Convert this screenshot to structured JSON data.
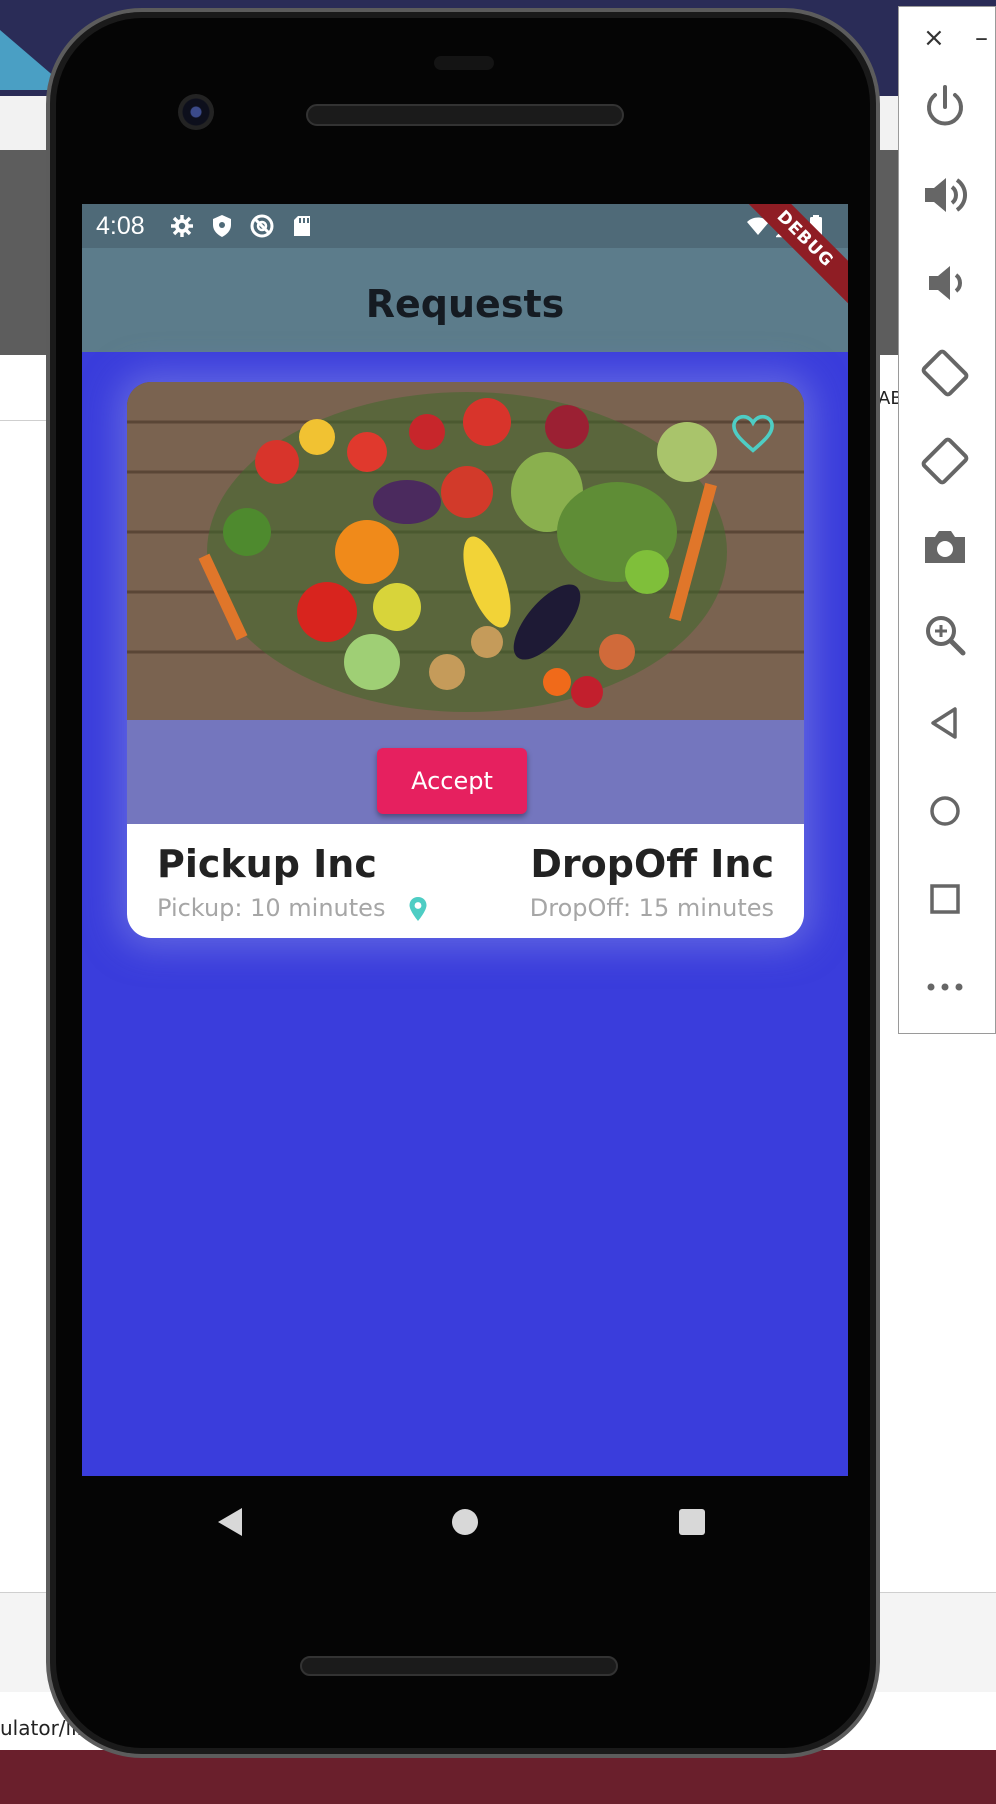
{
  "status_bar": {
    "time": "4:08",
    "left_icons": [
      "settings-icon",
      "shield-icon",
      "no-disturb-icon",
      "sd-card-icon"
    ],
    "right_icons": [
      "wifi-icon",
      "signal-icon",
      "battery-icon"
    ]
  },
  "debug_banner": "DEBUG",
  "app_bar": {
    "title": "Requests"
  },
  "request_card": {
    "image_alt": "Vegetables arranged in a heart shape",
    "favorite_icon": "heart-outline-icon",
    "accept_label": "Accept",
    "pickup": {
      "name": "Pickup Inc",
      "time_text": "Pickup: 10 minutes",
      "icon": "location-pin-icon"
    },
    "dropoff": {
      "name": "DropOff Inc",
      "time_text": "DropOff: 15 minutes"
    }
  },
  "nav_bar": [
    "back-icon",
    "home-icon",
    "recents-icon"
  ],
  "emulator_controls": {
    "close": "×",
    "minimize": "–",
    "buttons": [
      "power-icon",
      "volume-up-icon",
      "volume-down-icon",
      "rotate-left-icon",
      "rotate-right-icon",
      "camera-icon",
      "zoom-icon",
      "back-icon",
      "home-icon",
      "overview-icon",
      "more-icon"
    ]
  },
  "desktop": {
    "path_text": "ulator/lib",
    "side_text": "AB"
  },
  "colors": {
    "screen_background": "#3a3ddc",
    "app_bar": "#5c7c8b",
    "status_bar": "#4f6a78",
    "accept_button": "#e6205f",
    "accent_teal": "#4ecdc4"
  }
}
